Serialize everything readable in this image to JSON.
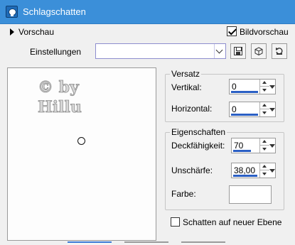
{
  "window": {
    "title": "Schlagschatten"
  },
  "preview": {
    "toggle_label": "Vorschau",
    "bild_label": "Bildvorschau",
    "bild_checked": true,
    "watermark_lines": [
      "© by",
      "Hillu"
    ]
  },
  "settings": {
    "label": "Einstellungen",
    "value": ""
  },
  "versatz": {
    "title": "Versatz",
    "vertikal_label": "Vertikal:",
    "vertikal_value": "0",
    "horizontal_label": "Horizontal:",
    "horizontal_value": "0"
  },
  "eigenschaften": {
    "title": "Eigenschaften",
    "deck_label": "Deckfähigkeit:",
    "deck_value": "70",
    "deck_fill": 0.7,
    "unsch_label": "Unschärfe:",
    "unsch_value": "38,00",
    "farbe_label": "Farbe:",
    "farbe_color": "#ffffff"
  },
  "shadow_layer": {
    "label": "Schatten auf neuer Ebene",
    "checked": false
  },
  "colors": {
    "titlebar": "#3b8fd9",
    "accent": "#2b5fc4"
  },
  "icons": {
    "app": "shadow-app-icon",
    "save": "floppy-icon",
    "load": "cube-icon",
    "reset": "reset-icon"
  }
}
